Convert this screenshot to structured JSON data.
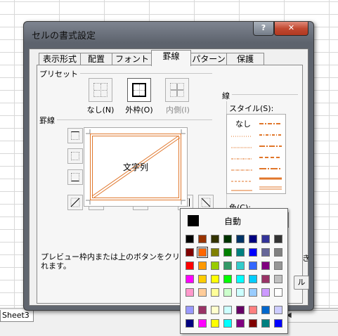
{
  "sheet": {
    "tab_label": "Sheet3"
  },
  "dialog": {
    "title": "セルの書式設定",
    "help_glyph": "?",
    "close_glyph": "✕",
    "tabs": [
      "表示形式",
      "配置",
      "フォント",
      "罫線",
      "パターン",
      "保護"
    ],
    "active_tab": "罫線",
    "preset_label": "プリセット",
    "presets": [
      {
        "label": "なし(N)"
      },
      {
        "label": "外枠(O)"
      },
      {
        "label": "内側(I)"
      }
    ],
    "border_label": "罫線",
    "preview_text": "文字列",
    "line_group_label": "線",
    "style_label": "スタイル(S):",
    "style_none": "なし",
    "color_label": "色(C):",
    "color_value": "#EC6B10",
    "note": "プレビュー枠内または上のボタンをクリックす",
    "note_line2": "れます。",
    "note_tail": "き",
    "bottom_button_fragment": "ル"
  },
  "color_popup": {
    "auto_label": "自動",
    "rows": [
      [
        "#000000",
        "#993300",
        "#333300",
        "#003300",
        "#003366",
        "#000080",
        "#333399",
        "#333333"
      ],
      [
        "#800000",
        "#FF6600",
        "#808000",
        "#008000",
        "#008080",
        "#0000FF",
        "#666699",
        "#808080"
      ],
      [
        "#FF0000",
        "#FF9900",
        "#99CC00",
        "#339966",
        "#33CCCC",
        "#3366FF",
        "#800080",
        "#969696"
      ],
      [
        "#FF00FF",
        "#FFCC00",
        "#FFFF00",
        "#00FF00",
        "#00FFFF",
        "#00CCFF",
        "#993366",
        "#C0C0C0"
      ],
      [
        "#FF99CC",
        "#FFCC99",
        "#FFFF99",
        "#CCFFCC",
        "#CCFFFF",
        "#99CCFF",
        "#CC99FF",
        "#FFFFFF"
      ],
      [
        "#9999FF",
        "#993366",
        "#FFFFCC",
        "#CCFFFF",
        "#660066",
        "#FF8080",
        "#0066CC",
        "#CCCCFF"
      ],
      [
        "#000080",
        "#FF00FF",
        "#FFFF00",
        "#00FFFF",
        "#800080",
        "#800000",
        "#008080",
        "#0000FF"
      ]
    ],
    "selected": [
      1,
      1
    ]
  }
}
